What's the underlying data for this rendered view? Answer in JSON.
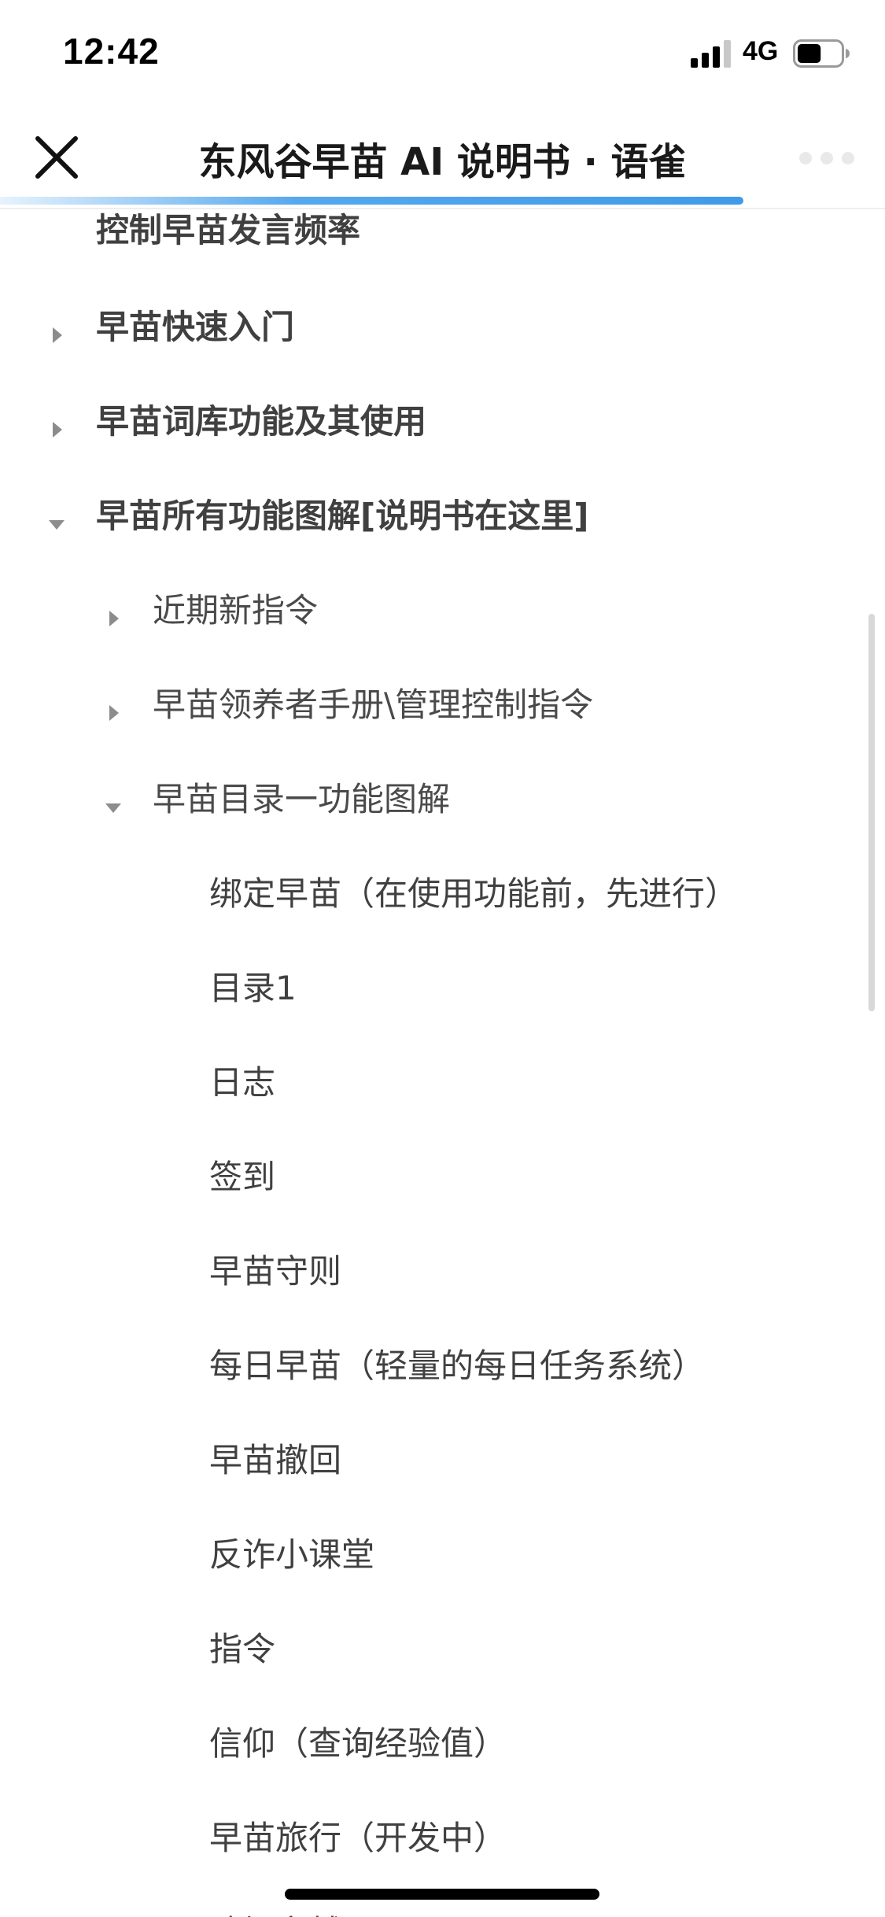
{
  "status_bar": {
    "time": "12:42",
    "network": "4G",
    "battery_level": 0.55
  },
  "header": {
    "title": "东风谷早苗 AI 说明书 · 语雀",
    "load_progress": 0.84,
    "accent_color": "#3f9be8"
  },
  "tree": {
    "partial_item": "控制早苗发言频率",
    "items": [
      {
        "label": "早苗快速入门",
        "state": "collapsed"
      },
      {
        "label": "早苗词库功能及其使用",
        "state": "collapsed"
      },
      {
        "label": "早苗所有功能图解[说明书在这里]",
        "state": "expanded"
      },
      {
        "label": "近期新指令",
        "state": "collapsed"
      },
      {
        "label": "早苗领养者手册\\管理控制指令",
        "state": "collapsed"
      },
      {
        "label": "早苗目录一功能图解",
        "state": "expanded"
      }
    ],
    "leaves": [
      "绑定早苗（在使用功能前，先进行）",
      "目录1",
      "日志",
      "签到",
      "早苗守则",
      "每日早苗（轻量的每日任务系统）",
      "早苗撤回",
      "反诈小课堂",
      "指令",
      "信仰（查询经验值）",
      "早苗旅行（开发中）",
      "赌场穿越"
    ]
  }
}
